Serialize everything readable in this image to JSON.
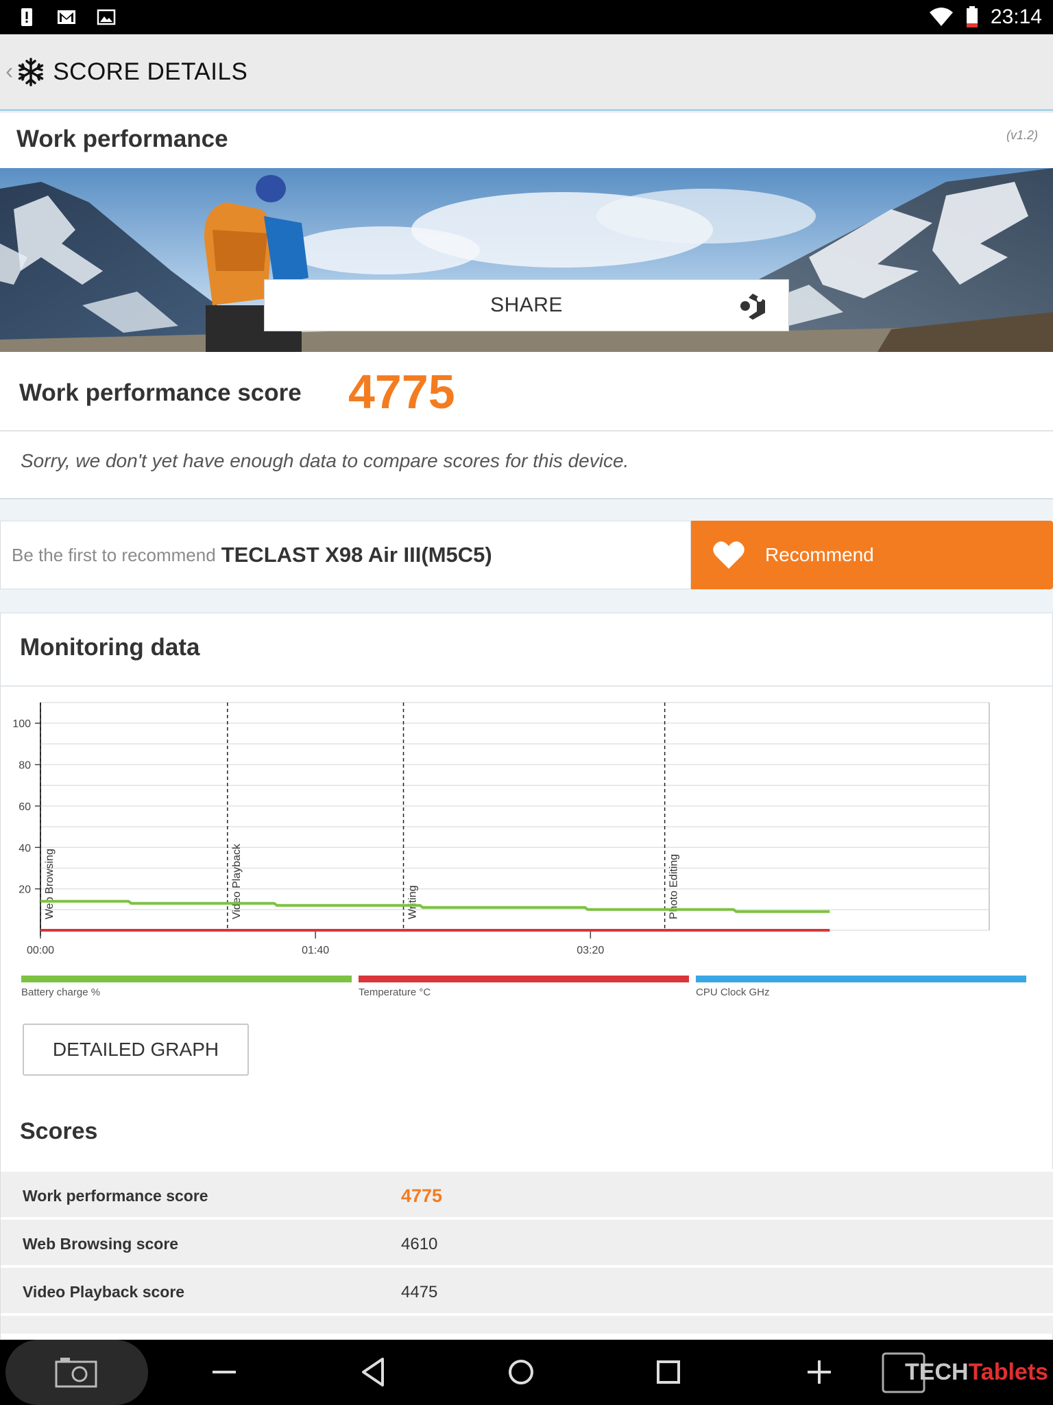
{
  "status_bar": {
    "time": "23:14",
    "icons": [
      "alert-icon",
      "gmail-icon",
      "gallery-icon",
      "wifi-icon",
      "battery-icon"
    ]
  },
  "action_bar": {
    "title": "SCORE DETAILS",
    "back_glyph": "‹"
  },
  "section": {
    "title": "Work performance",
    "version": "(v1.2)"
  },
  "share": {
    "label": "SHARE"
  },
  "score": {
    "label": "Work performance score",
    "value": "4775",
    "notice": "Sorry, we don't yet have enough data to compare scores for this device."
  },
  "recommend": {
    "prefix": "Be the first to recommend",
    "device": "TECLAST X98 Air III(M5C5)",
    "button_label": "Recommend"
  },
  "monitoring": {
    "title": "Monitoring data",
    "detailed_button": "DETAILED GRAPH"
  },
  "chart_data": {
    "type": "line",
    "x_ticks": [
      "00:00",
      "01:40",
      "03:20"
    ],
    "y_ticks": [
      "100",
      "80",
      "60",
      "40",
      "20"
    ],
    "ylim": [
      0,
      110
    ],
    "xlim_seconds": [
      0,
      345
    ],
    "grid": true,
    "phase_markers": [
      {
        "label": "Web Browsing",
        "t": 0
      },
      {
        "label": "Video Playback",
        "t": 68
      },
      {
        "label": "Writing",
        "t": 132
      },
      {
        "label": "Photo Editing",
        "t": 227
      }
    ],
    "series": [
      {
        "name": "Battery charge %",
        "color": "#7dc242",
        "points": [
          [
            0,
            14
          ],
          [
            32,
            14
          ],
          [
            33,
            13
          ],
          [
            85,
            13
          ],
          [
            86,
            12
          ],
          [
            138,
            12
          ],
          [
            139,
            11
          ],
          [
            198,
            11
          ],
          [
            199,
            10
          ],
          [
            252,
            10
          ],
          [
            253,
            9
          ],
          [
            287,
            9
          ]
        ]
      },
      {
        "name": "Temperature °C",
        "color": "#d8363a",
        "points": [
          [
            0,
            0
          ],
          [
            287,
            0
          ]
        ]
      }
    ],
    "legend": [
      {
        "name": "Battery charge %",
        "color": "#7dc242"
      },
      {
        "name": "Temperature °C",
        "color": "#d8363a"
      },
      {
        "name": "CPU Clock GHz",
        "color": "#3aa7e4"
      }
    ],
    "legend_position": "bottom"
  },
  "scores": {
    "title": "Scores",
    "rows": [
      {
        "label": "Work performance score",
        "value": "4775",
        "highlight": true
      },
      {
        "label": "Web Browsing score",
        "value": "4610"
      },
      {
        "label": "Video Playback score",
        "value": "4475"
      }
    ]
  },
  "nav_bar": {
    "watermark_a": "TECH",
    "watermark_b": "Tablets"
  },
  "colors": {
    "accent": "#f47c20",
    "battery": "#7dc242",
    "temperature": "#d8363a",
    "cpu": "#3aa7e4"
  }
}
